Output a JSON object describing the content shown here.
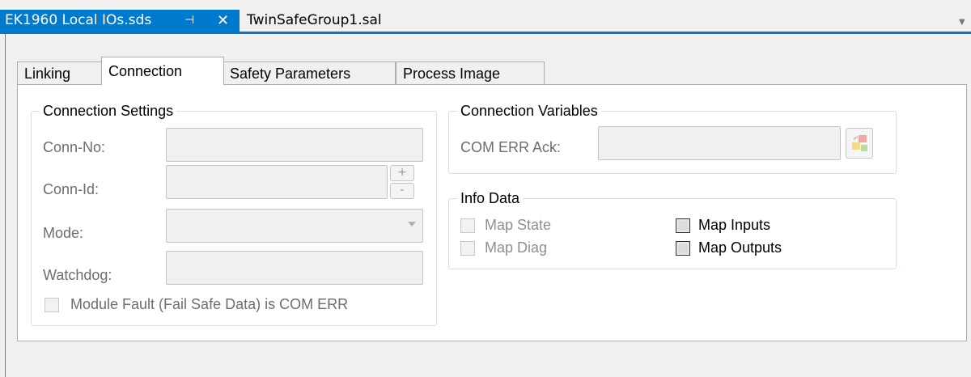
{
  "document_tabs": {
    "active": {
      "title": "EK1960 Local IOs.sds",
      "pin_glyph": "⊣",
      "close_glyph": "✕"
    },
    "inactive": {
      "title": "TwinSafeGroup1.sal"
    },
    "overflow_glyph": "▼"
  },
  "inner_tabs": [
    {
      "label": "Linking"
    },
    {
      "label": "Connection"
    },
    {
      "label": "Safety Parameters"
    },
    {
      "label": "Process Image"
    }
  ],
  "connection_settings": {
    "title": "Connection Settings",
    "conn_no_label": "Conn-No:",
    "conn_id_label": "Conn-Id:",
    "mode_label": "Mode:",
    "watchdog_label": "Watchdog:",
    "spin_up": "+",
    "spin_down": "-",
    "module_fault_label": "Module Fault (Fail Safe Data) is COM ERR"
  },
  "connection_variables": {
    "title": "Connection Variables",
    "com_err_ack_label": "COM ERR Ack:"
  },
  "info_data": {
    "title": "Info Data",
    "map_state": "Map State",
    "map_diag": "Map Diag",
    "map_inputs": "Map Inputs",
    "map_outputs": "Map Outputs"
  },
  "colors": {
    "accent": "#007acc",
    "disabled_text": "#6d6d6d"
  }
}
